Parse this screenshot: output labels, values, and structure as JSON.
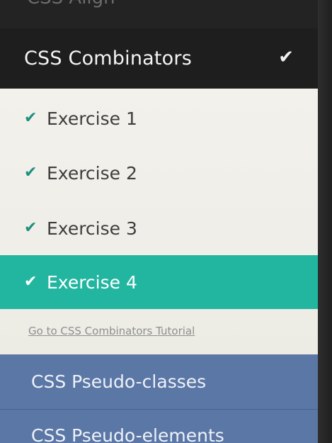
{
  "top_item": {
    "label": "CSS Align"
  },
  "section": {
    "title": "CSS Combinators",
    "complete_icon": "check-icon"
  },
  "exercises": [
    {
      "label": "Exercise 1",
      "icon": "check-icon",
      "active": false
    },
    {
      "label": "Exercise 2",
      "icon": "check-icon",
      "active": false
    },
    {
      "label": "Exercise 3",
      "icon": "check-icon",
      "active": false
    },
    {
      "label": "Exercise 4",
      "icon": "check-icon",
      "active": true
    }
  ],
  "tutorial_link": {
    "label": "Go to CSS Combinators Tutorial"
  },
  "nav": {
    "pseudo_classes": "CSS Pseudo-classes",
    "pseudo_elements": "CSS Pseudo-elements"
  },
  "colors": {
    "header_bg": "#1e1e1e",
    "panel_bg": "#f0eee8",
    "active_bg": "#22b6a0",
    "check_green": "#1f8f7f",
    "nav_bg": "#5b77a6"
  }
}
